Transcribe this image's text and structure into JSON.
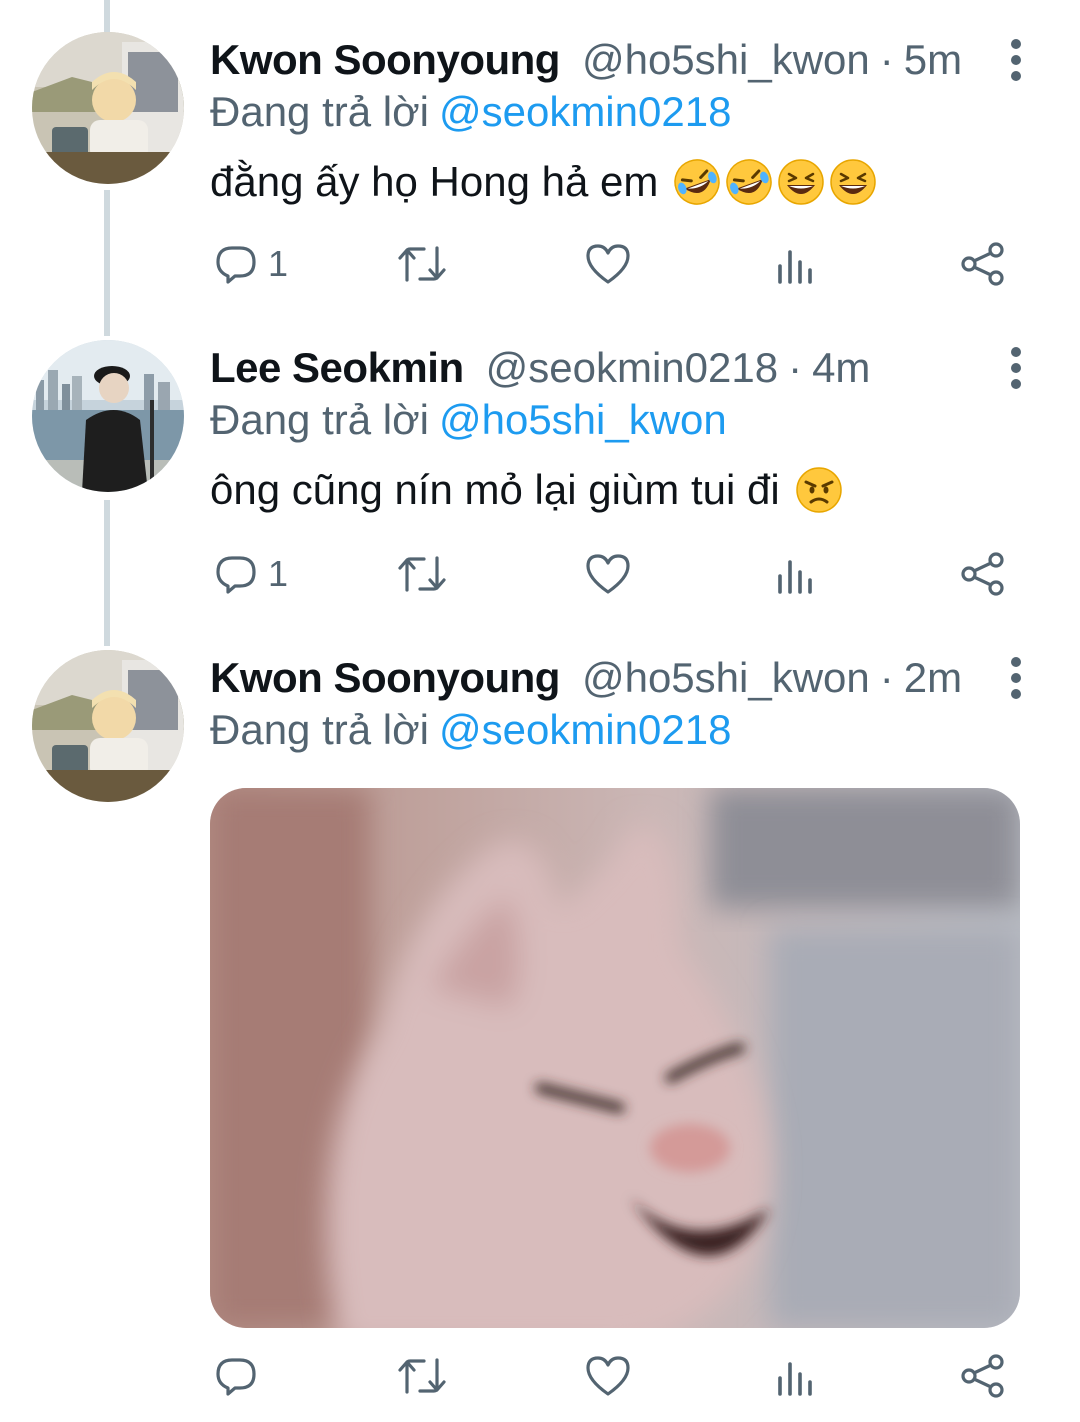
{
  "tweets": [
    {
      "display_name": "Kwon Soonyoung",
      "handle": "@ho5shi_kwon",
      "separator": "·",
      "time": "5m",
      "replying_label": "Đang trả lời",
      "replying_to": "@seokmin0218",
      "text": "đằng ấy họ Hong hả em",
      "emojis": [
        "rolling-on-floor-laughing",
        "rolling-on-floor-laughing",
        "grinning-squinting-face",
        "grinning-squinting-face"
      ],
      "reply_count": "1"
    },
    {
      "display_name": "Lee Seokmin",
      "handle": "@seokmin0218",
      "separator": "·",
      "time": "4m",
      "replying_label": "Đang trả lời",
      "replying_to": "@ho5shi_kwon",
      "text": "ông cũng nín mỏ lại giùm tui đi",
      "emojis": [
        "angry-face"
      ],
      "reply_count": "1"
    },
    {
      "display_name": "Kwon Soonyoung",
      "handle": "@ho5shi_kwon",
      "separator": "·",
      "time": "2m",
      "replying_label": "Đang trả lời",
      "replying_to": "@seokmin0218",
      "media": "blurry-laughing-cat-photo",
      "reply_count": ""
    }
  ],
  "icons": {
    "reply": "reply-icon",
    "retweet": "retweet-icon",
    "like": "heart-icon",
    "analytics": "analytics-icon",
    "share": "share-icon",
    "more": "more-vertical-icon"
  },
  "colors": {
    "mention": "#1d9bf0",
    "secondary_text": "#536471",
    "thread_line": "#cfd9de"
  }
}
